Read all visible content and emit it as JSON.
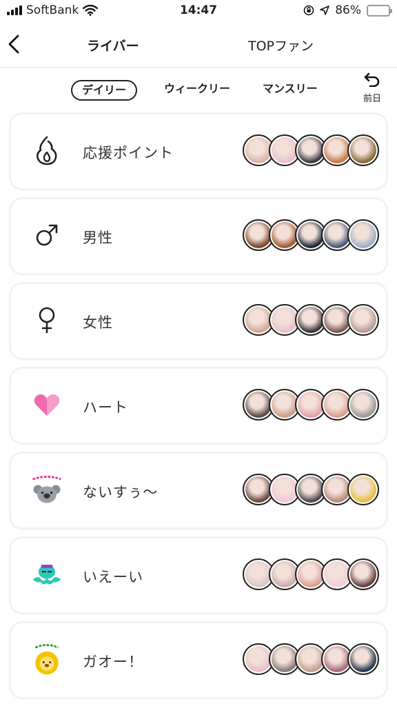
{
  "status_bar": {
    "carrier": "SoftBank",
    "time": "14:47",
    "battery": "86%",
    "battery_level": 0.86
  },
  "navbar": {
    "tabs": [
      "ライバー",
      "TOPファン"
    ]
  },
  "period_tabs": {
    "items": [
      "デイリー",
      "ウィークリー",
      "マンスリー"
    ],
    "selected": "デイリー",
    "prev_label": "前日"
  },
  "categories": [
    {
      "label": "応援ポイント",
      "icon": "flame-icon",
      "avatars": [
        "#d9b7a8",
        "#e8c2cc",
        "#3e3a45",
        "#c97a4a",
        "#8a6a3a"
      ]
    },
    {
      "label": "男性",
      "icon": "male-symbol-icon",
      "avatars": [
        "#7a4a2a",
        "#a05a32",
        "#1e2838",
        "#4a5a78",
        "#9fb0c8"
      ]
    },
    {
      "label": "女性",
      "icon": "female-symbol-icon",
      "avatars": [
        "#d4a898",
        "#e8c2cc",
        "#3a3538",
        "#7a5a52",
        "#b89a9a"
      ]
    },
    {
      "label": "ハート",
      "icon": "heart-icon",
      "avatars": [
        "#5a4a4a",
        "#c8a08a",
        "#e6a0a8",
        "#d8a090",
        "#9a9a9a"
      ]
    },
    {
      "label": "ないすぅ〜",
      "icon": "koala-sticker-icon",
      "avatars": [
        "#6a4a42",
        "#f2c8d8",
        "#4a4a4a",
        "#b88a7a",
        "#e8c040"
      ]
    },
    {
      "label": "いえーい",
      "icon": "octopus-sticker-icon",
      "avatars": [
        "#d8c8c8",
        "#c8b0b0",
        "#d8a090",
        "#f2d0dc",
        "#6a4040"
      ]
    },
    {
      "label": "ガオー！",
      "icon": "lion-sticker-icon",
      "avatars": [
        "#e8c0c8",
        "#8a7a7a",
        "#c8a090",
        "#a86a7a",
        "#2a3a50"
      ]
    }
  ],
  "colors": {
    "accent": "#222222",
    "heart": "#f06ab0",
    "sticker_lion": "#f5c400",
    "sticker_octopus": "#2ec9b5"
  }
}
